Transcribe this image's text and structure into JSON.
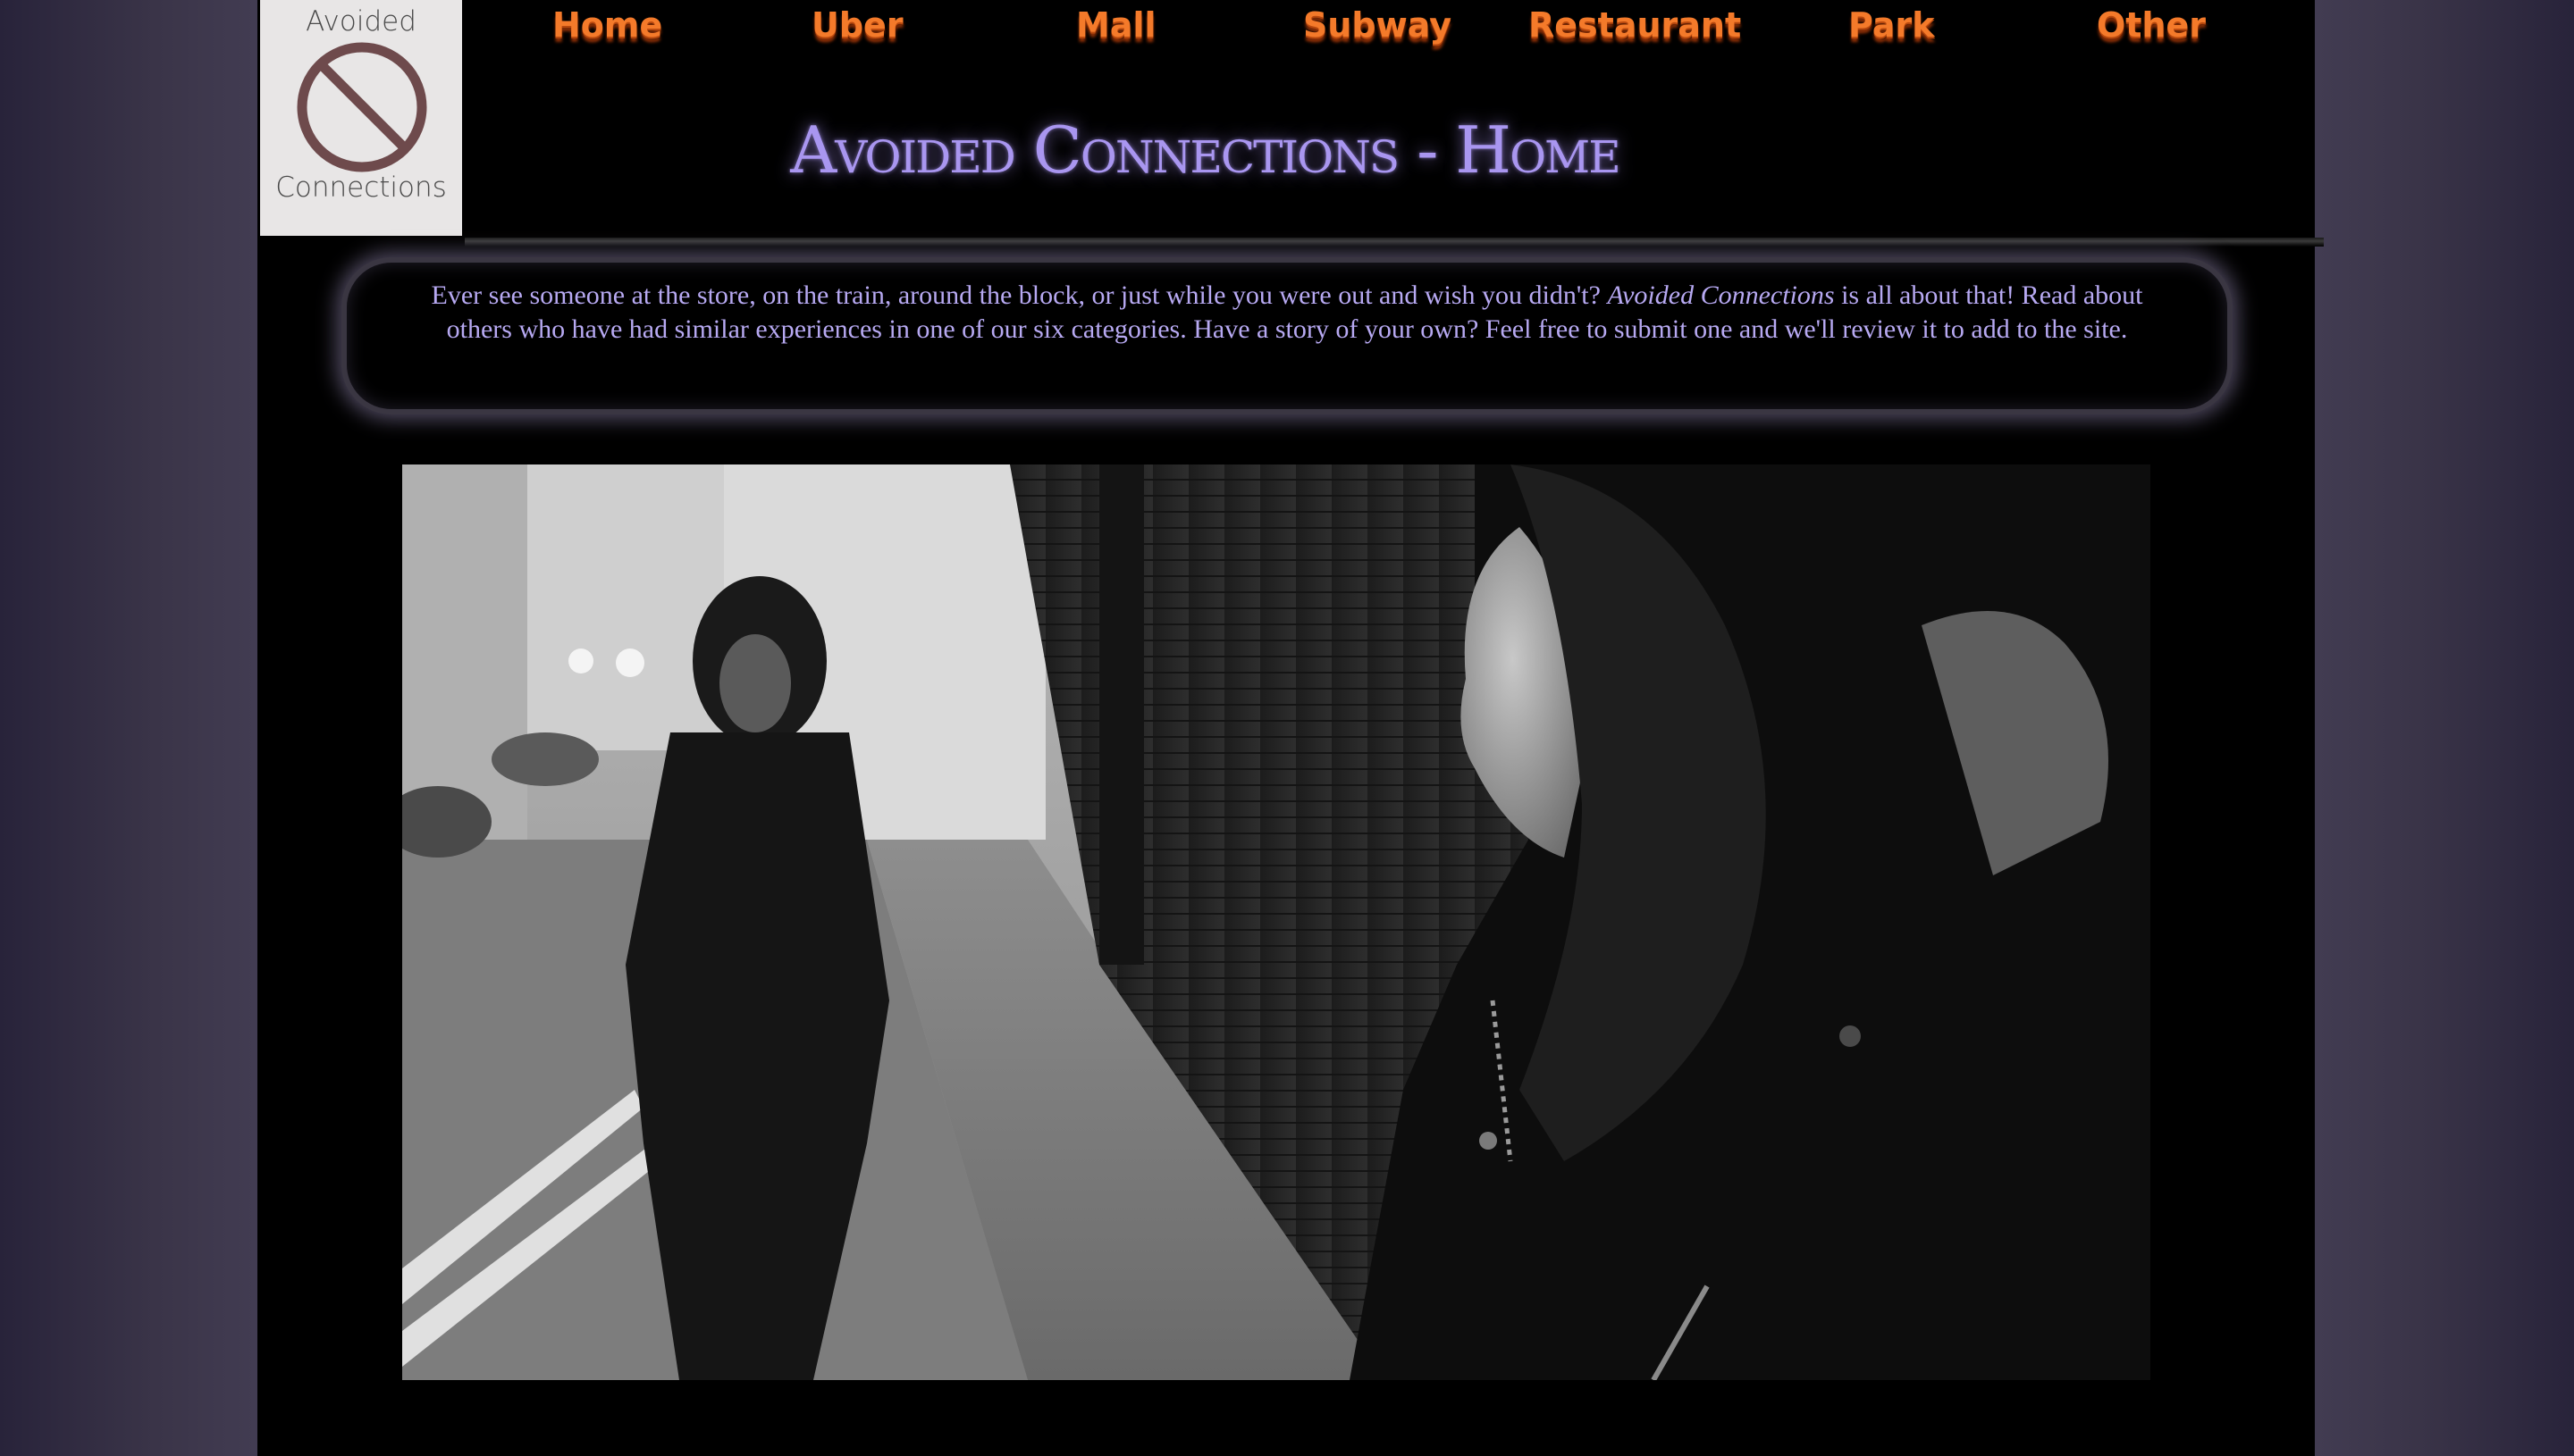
{
  "logo": {
    "line1": "Avoided",
    "line2": "Connections",
    "icon": "prohibited-icon",
    "icon_color": "#6e4a4c"
  },
  "nav": {
    "items": [
      {
        "label": "Home"
      },
      {
        "label": "Uber"
      },
      {
        "label": "Mall"
      },
      {
        "label": "Subway"
      },
      {
        "label": "Restaurant"
      },
      {
        "label": "Park"
      },
      {
        "label": "Other"
      }
    ],
    "color": "#f47a2a"
  },
  "header": {
    "title": "Avoided Connections - Home",
    "title_color": "#a996f0"
  },
  "intro": {
    "part1": "Ever see someone at the store, on the train, around the block, or just while you were out and wish you didn't? ",
    "emphasis": "Avoided Connections",
    "part2": " is all about that! Read about others who have had similar experiences in one of our six categories. Have a story of your own? Feel free to submit one and we'll review it to add to the site.",
    "text_color": "#b7a9f2"
  },
  "hero": {
    "description": ""
  }
}
